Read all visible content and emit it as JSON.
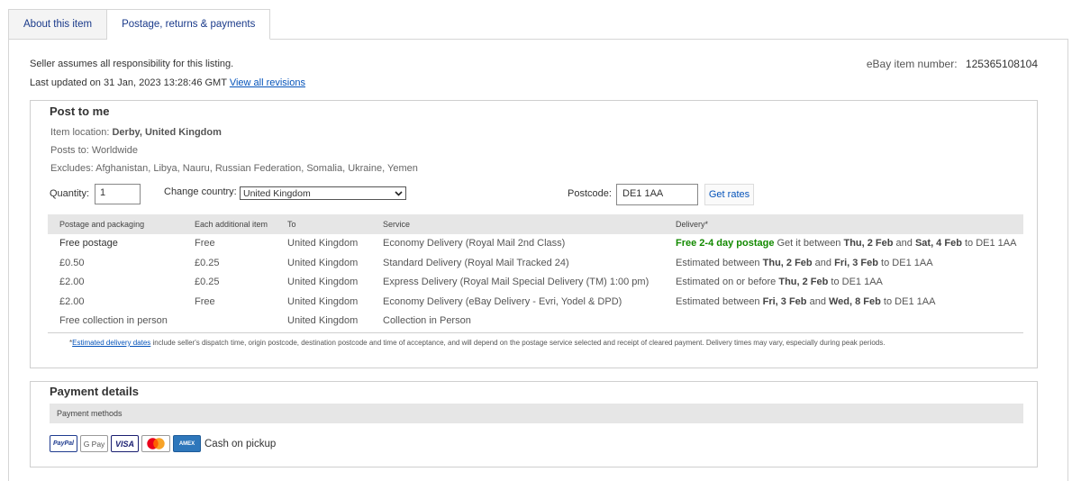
{
  "tabs": [
    {
      "label": "About this item",
      "active": false
    },
    {
      "label": "Postage, returns & payments",
      "active": true
    }
  ],
  "header": {
    "seller_text": "Seller assumes all responsibility for this listing.",
    "updated_text": "Last updated on 31 Jan, 2023 13:28:46 GMT",
    "revisions_link": "View all revisions",
    "item_number_label": "eBay item number:",
    "item_number": "125365108104"
  },
  "post": {
    "title": "Post to me",
    "location_label": "Item location:",
    "location_value": "Derby, United Kingdom",
    "posts_to_label": "Posts to:",
    "posts_to_value": "Worldwide",
    "excludes_label": "Excludes:",
    "excludes_value": "Afghanistan, Libya, Nauru, Russian Federation, Somalia, Ukraine, Yemen",
    "quantity_label": "Quantity:",
    "quantity_value": "1",
    "country_label": "Change country:",
    "country_value": "United Kingdom",
    "postcode_label": "Postcode:",
    "postcode_value": "DE1 1AA",
    "get_rates": "Get rates"
  },
  "table": {
    "headers": [
      "Postage and packaging",
      "Each additional item",
      "To",
      "Service",
      "Delivery*"
    ],
    "rows": [
      {
        "cost": "Free postage",
        "additional": "Free",
        "to": "United Kingdom",
        "service": "Economy Delivery (Royal Mail 2nd Class)",
        "delivery_highlight": "Free 2-4 day postage",
        "delivery_pre": " Get it between ",
        "delivery_date1": "Thu, 2 Feb",
        "delivery_mid": " and ",
        "delivery_date2": "Sat, 4 Feb",
        "delivery_post": " to DE1 1AA"
      },
      {
        "cost": "£0.50",
        "additional": "£0.25",
        "to": "United Kingdom",
        "service": "Standard Delivery (Royal Mail Tracked 24)",
        "delivery_pre": "Estimated between ",
        "delivery_date1": "Thu, 2 Feb",
        "delivery_mid": " and ",
        "delivery_date2": "Fri, 3 Feb",
        "delivery_post": " to DE1 1AA"
      },
      {
        "cost": "£2.00",
        "additional": "£0.25",
        "to": "United Kingdom",
        "service": "Express Delivery (Royal Mail Special Delivery (TM) 1:00 pm)",
        "delivery_pre": "Estimated on or before ",
        "delivery_date1": "Thu, 2 Feb",
        "delivery_post": " to DE1 1AA"
      },
      {
        "cost": "£2.00",
        "additional": "Free",
        "to": "United Kingdom",
        "service": "Economy Delivery (eBay Delivery - Evri, Yodel & DPD)",
        "delivery_pre": "Estimated between ",
        "delivery_date1": "Fri, 3 Feb",
        "delivery_mid": " and ",
        "delivery_date2": "Wed, 8 Feb",
        "delivery_post": " to DE1 1AA"
      },
      {
        "cost": "Free collection in person",
        "additional": "",
        "to": "United Kingdom",
        "service": "Collection in Person"
      }
    ],
    "footnote_star": "*",
    "footnote_link": "Estimated delivery dates",
    "footnote_text": " include seller's dispatch time, origin postcode, destination postcode and time of acceptance, and will depend on the postage service selected and receipt of cleared payment. Delivery times may vary, especially during peak periods."
  },
  "payment": {
    "title": "Payment details",
    "methods_header": "Payment methods",
    "methods": [
      {
        "name": "PayPal",
        "icon": "paypal-icon"
      },
      {
        "name": "G Pay",
        "icon": "google-pay-icon"
      },
      {
        "name": "VISA",
        "icon": "visa-icon"
      },
      {
        "name": "Mastercard",
        "icon": "mastercard-icon"
      },
      {
        "name": "AMEX",
        "icon": "amex-icon"
      }
    ],
    "cash_text": "Cash on pickup"
  },
  "colors": {
    "link": "#0654ba",
    "green": "#138a00",
    "header_bg": "#e6e6e6",
    "border": "#cfcfcf"
  }
}
